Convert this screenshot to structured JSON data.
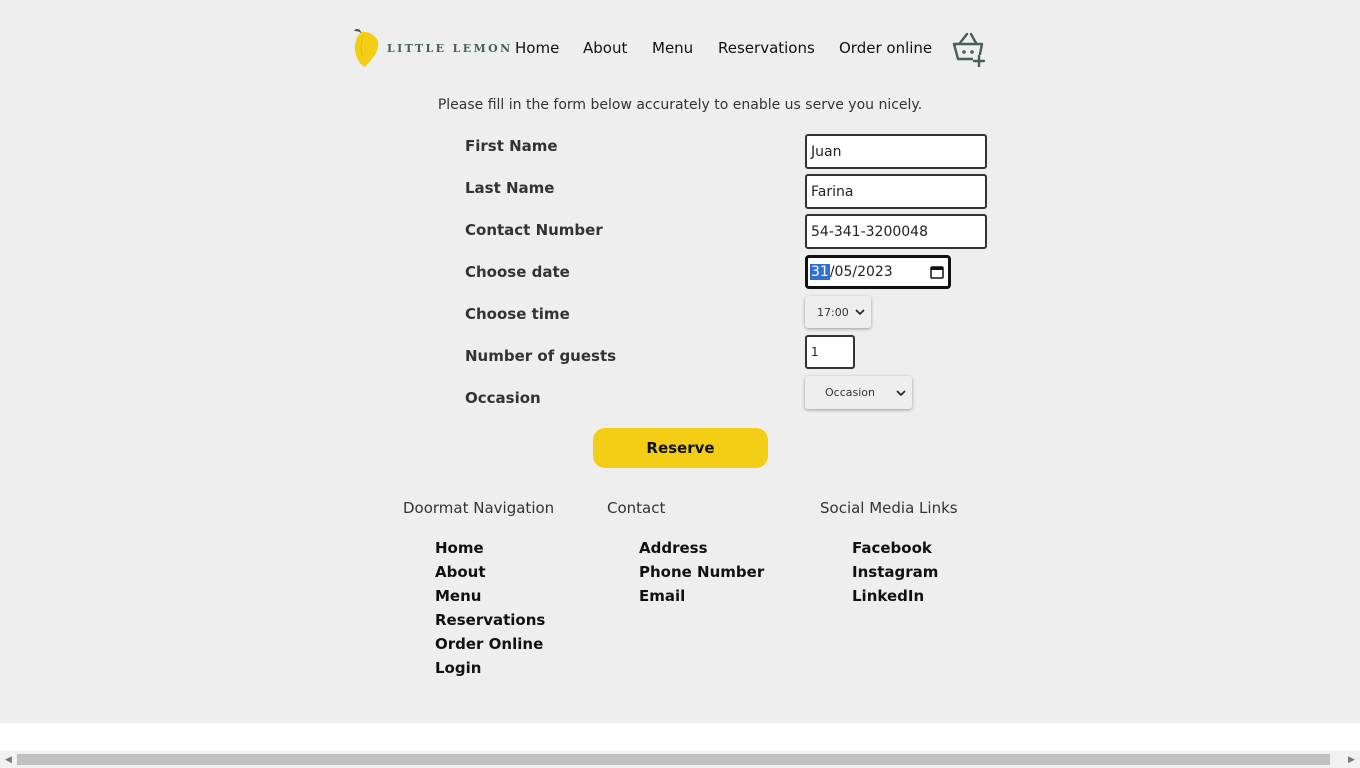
{
  "brand": {
    "logo_text": "LITTLE LEMON",
    "accent": "#f4ce14",
    "green": "#495e57"
  },
  "nav": {
    "home": "Home",
    "about": "About",
    "menu": "Menu",
    "reservations": "Reservations",
    "order_online": "Order online",
    "basket_icon": "basket-add-icon"
  },
  "intro": "Please fill in the form below accurately to enable us serve you nicely.",
  "form": {
    "first_name": {
      "label": "First Name",
      "value": "Juan"
    },
    "last_name": {
      "label": "Last Name",
      "value": "Farina"
    },
    "contact": {
      "label": "Contact Number",
      "value": "54-341-3200048"
    },
    "date": {
      "label": "Choose date",
      "day": "31",
      "rest": "/05/2023"
    },
    "time": {
      "label": "Choose time",
      "value": "17:00"
    },
    "guests": {
      "label": "Number of guests",
      "value": "1"
    },
    "occasion": {
      "label": "Occasion",
      "value": "Occasion"
    },
    "submit": "Reserve"
  },
  "footer": {
    "nav": {
      "heading": "Doormat Navigation",
      "links": [
        "Home",
        "About",
        "Menu",
        "Reservations",
        "Order Online",
        "Login"
      ]
    },
    "contact": {
      "heading": "Contact",
      "links": [
        "Address",
        "Phone Number",
        "Email"
      ]
    },
    "social": {
      "heading": "Social Media Links",
      "links": [
        "Facebook",
        "Instagram",
        "LinkedIn"
      ]
    }
  }
}
